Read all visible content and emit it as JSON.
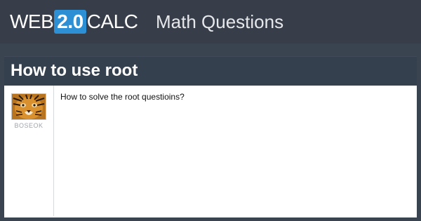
{
  "header": {
    "brand_web": "WEB",
    "brand_version": "2.0",
    "brand_calc": "CALC",
    "section": "Math Questions"
  },
  "question": {
    "title": "How to use root",
    "username": "BOSEOK",
    "text": "How to solve the root questioins?",
    "avatar_icon": "tiger-avatar"
  },
  "colors": {
    "background": "#3a4350",
    "accent": "#2d8fd4",
    "card": "#ffffff"
  }
}
